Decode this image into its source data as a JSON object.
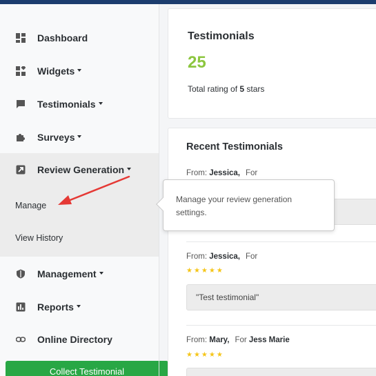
{
  "sidebar": {
    "items": [
      {
        "label": "Dashboard",
        "icon": "dashboard-icon",
        "has_caret": false
      },
      {
        "label": "Widgets",
        "icon": "widgets-icon",
        "has_caret": true
      },
      {
        "label": "Testimonials",
        "icon": "chat-icon",
        "has_caret": true
      },
      {
        "label": "Surveys",
        "icon": "puzzle-icon",
        "has_caret": true
      },
      {
        "label": "Review Generation",
        "icon": "external-link-icon",
        "has_caret": true
      },
      {
        "label": "Management",
        "icon": "shield-icon",
        "has_caret": true
      },
      {
        "label": "Reports",
        "icon": "chart-icon",
        "has_caret": true
      },
      {
        "label": "Online Directory",
        "icon": "link-icon",
        "has_caret": false
      }
    ],
    "submenu": [
      "Manage",
      "View History"
    ],
    "collect_button": "Collect Testimonial"
  },
  "summary": {
    "title": "Testimonials",
    "count": "25",
    "rating_prefix": "Total rating of",
    "rating_value": "5",
    "rating_suffix": "stars"
  },
  "recent": {
    "title": "Recent Testimonials",
    "items": [
      {
        "from_label": "From:",
        "name": "Jessica,",
        "for_label": "For",
        "for_value": "",
        "quote": ""
      },
      {
        "from_label": "From:",
        "name": "Jessica,",
        "for_label": "For",
        "for_value": "",
        "stars": "★★★★★",
        "quote": "\"Test testimonial\""
      },
      {
        "from_label": "From:",
        "name": "Mary,",
        "for_label": "For",
        "for_value": "Jess Marie",
        "stars": "★★★★★"
      }
    ]
  },
  "tooltip": {
    "text": "Manage your review generation settings."
  },
  "colors": {
    "accent_green": "#8cc63f",
    "button_green": "#28a745",
    "star": "#f5c518",
    "annotation_arrow": "#e53935",
    "topbar": "#1c3d6e"
  }
}
